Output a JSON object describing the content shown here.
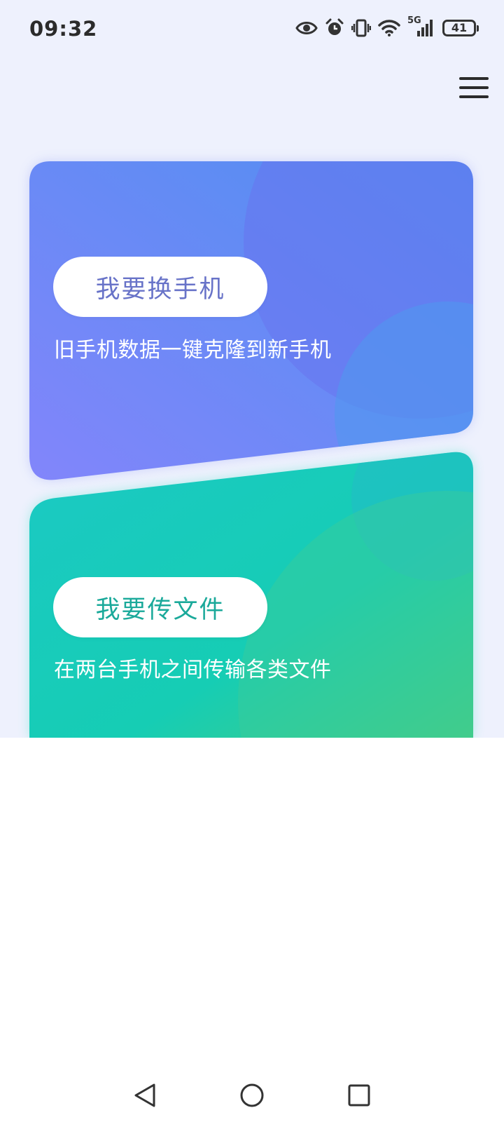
{
  "status_bar": {
    "time": "09:32",
    "network": "5G",
    "battery": "41"
  },
  "cards": {
    "switch_phone": {
      "button_label": "我要换手机",
      "description": "旧手机数据一键克隆到新手机"
    },
    "transfer_files": {
      "button_label": "我要传文件",
      "description": "在两台手机之间传输各类文件"
    }
  },
  "colors": {
    "page_background": "#eef1fd",
    "switch_card_start": "#5b8cf5",
    "switch_card_end": "#7f86f9",
    "transfer_card_start": "#18c9bf",
    "transfer_card_end": "#45cc84",
    "switch_label": "#6873c8",
    "transfer_label": "#1aa99a"
  },
  "icons": {
    "status": [
      "eye-icon",
      "alarm-icon",
      "vibrate-icon",
      "wifi-icon",
      "cellular-signal-icon",
      "battery-icon"
    ],
    "menu": "hamburger-menu-icon",
    "navigation": [
      "back-triangle-icon",
      "home-circle-icon",
      "recent-apps-square-icon"
    ]
  }
}
